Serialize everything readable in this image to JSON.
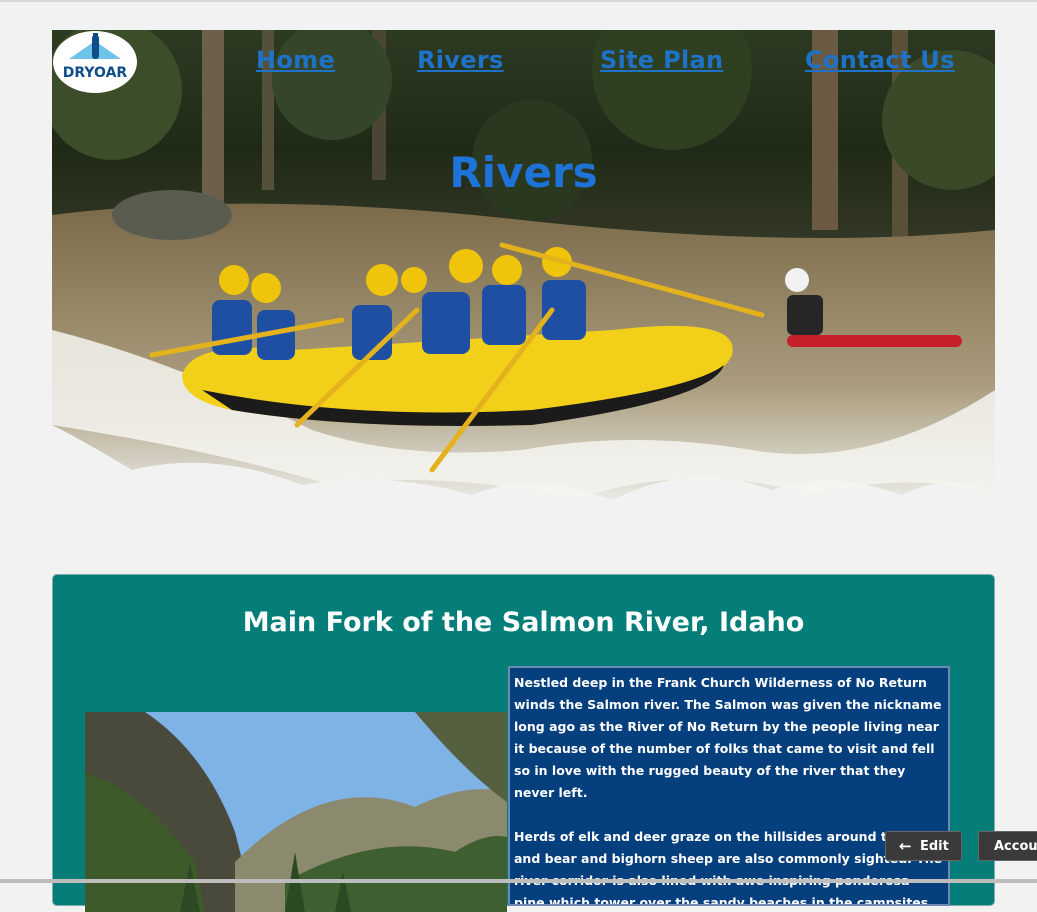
{
  "brand": {
    "logo_text": "DRYOAR"
  },
  "nav": {
    "home": "Home",
    "rivers": "Rivers",
    "site_plan": "Site Plan",
    "contact": "Contact Us"
  },
  "hero": {
    "title": "Rivers"
  },
  "section": {
    "title": "Main Fork of the Salmon River, Idaho",
    "paragraphs": [
      "Nestled deep in the Frank Church Wilderness of No Return winds the Salmon river. The Salmon was given the nickname long ago as the River of No Return by the people living near it because of the number of folks that came to visit and fell so in love with the rugged beauty of the river that they never left.",
      "Herds of elk and deer graze on the hillsides around the river and bear and bighorn sheep are also commonly sighted. The river corridor is also lined with awe inspiring ponderosa pine which tower over the sandy beaches in the campsites and provide shelter from sun or rain."
    ]
  },
  "toolbar": {
    "edit": "Edit",
    "account": "Account"
  },
  "colors": {
    "background": "#f2f2f2",
    "nav_link": "#1e73c8",
    "card": "#057e7a",
    "description_box": "#063f7e"
  }
}
